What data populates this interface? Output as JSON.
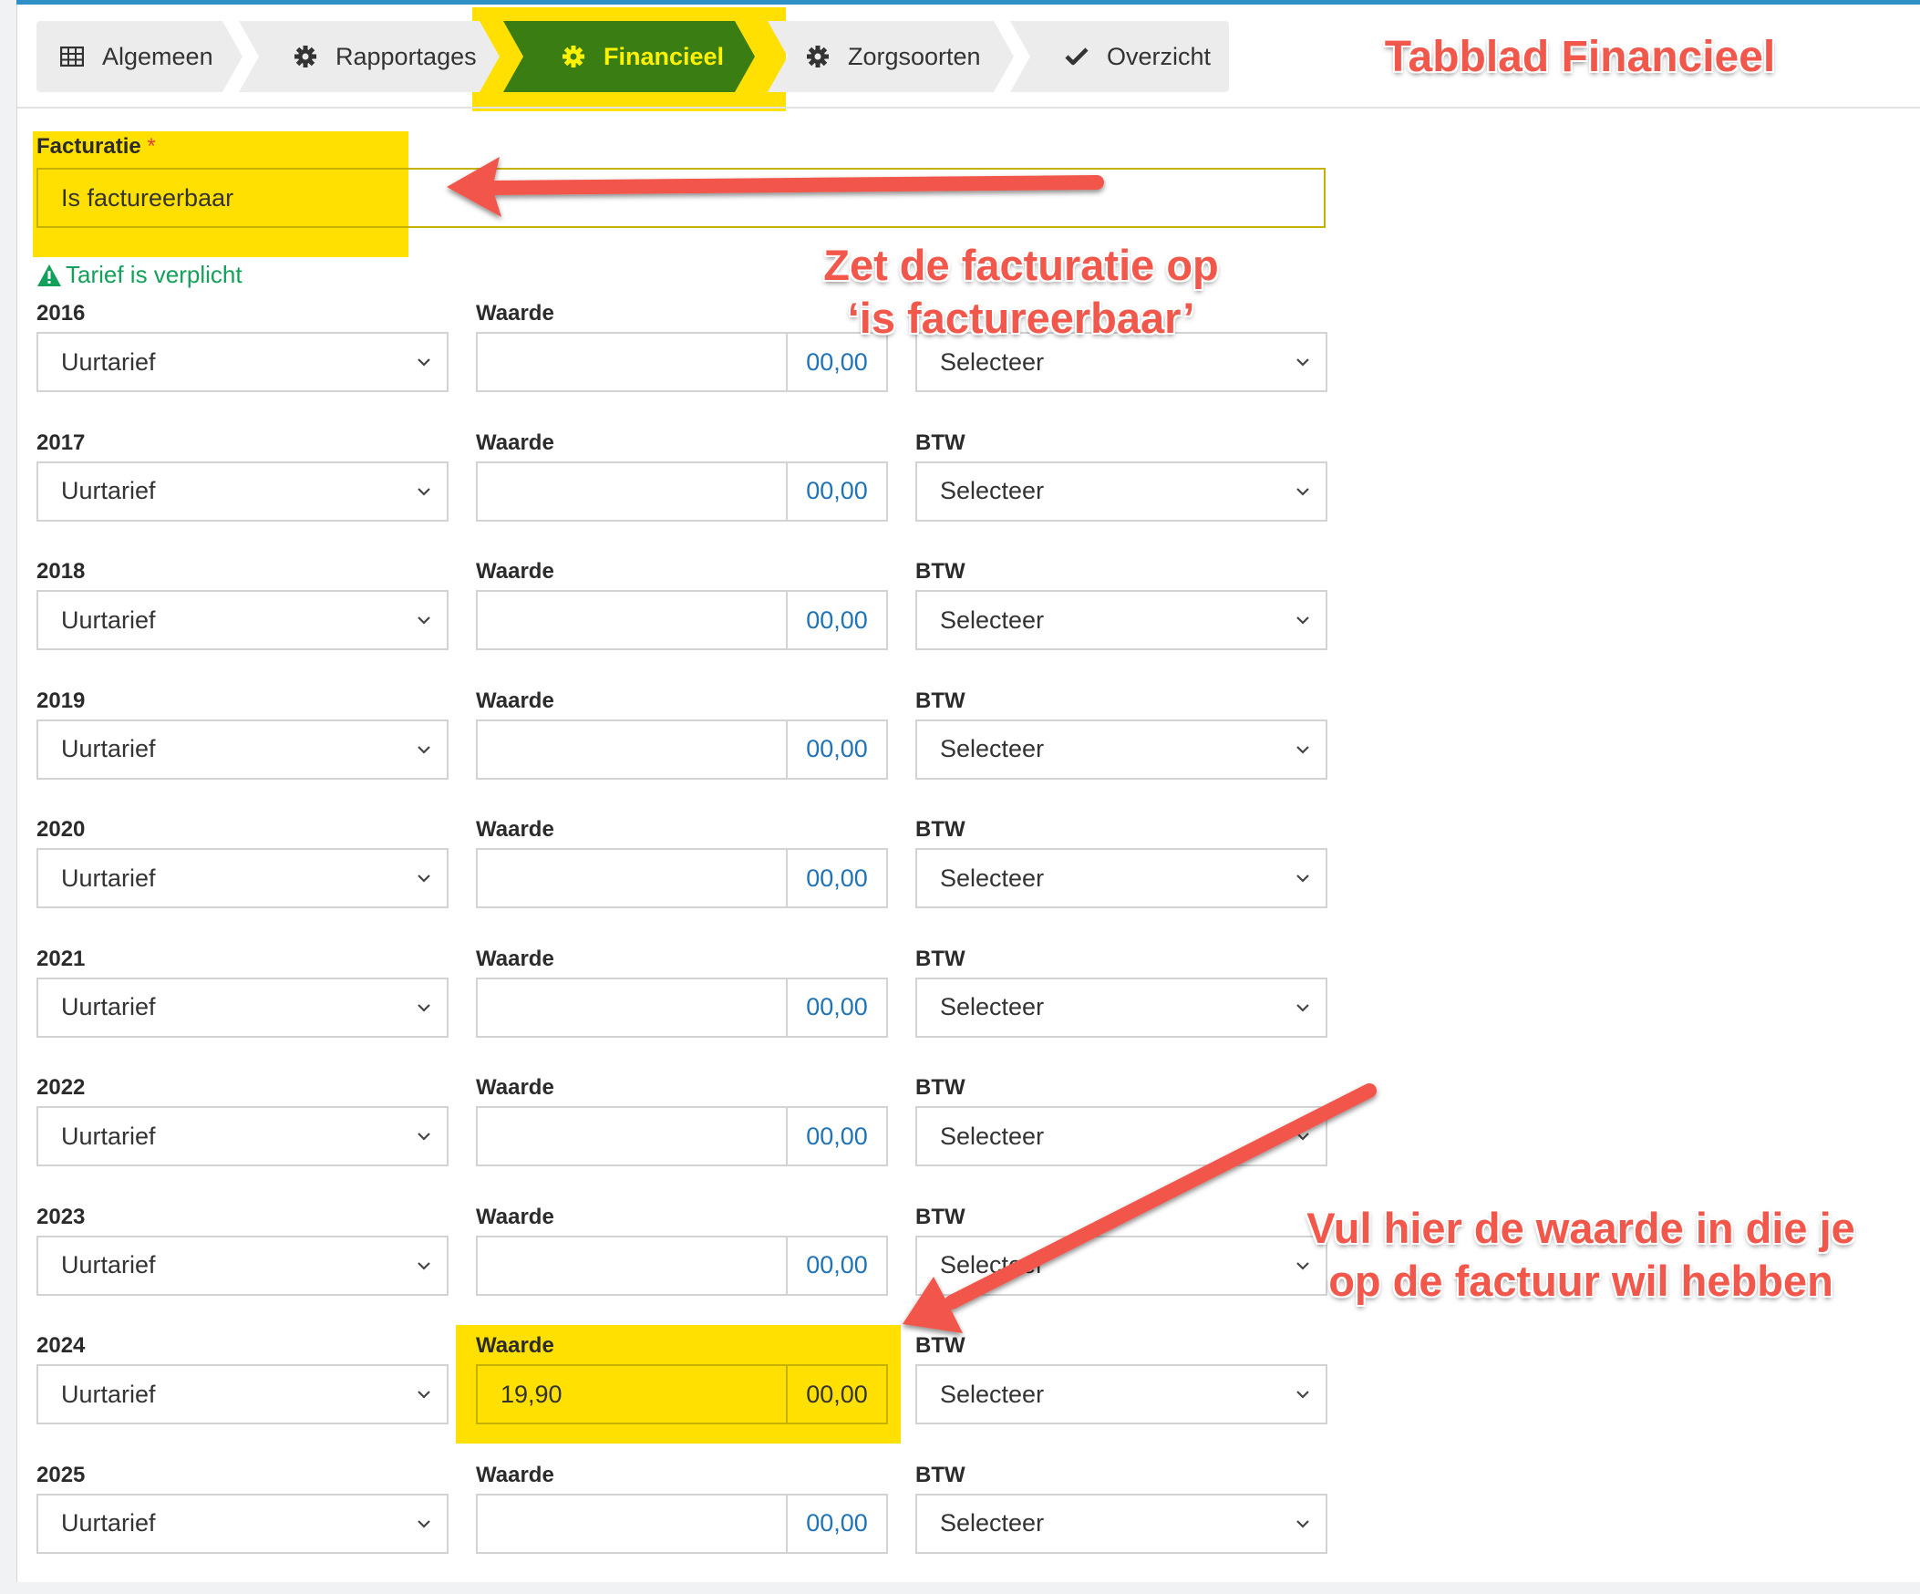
{
  "tabs": [
    {
      "label": "Algemeen",
      "icon": "table-icon"
    },
    {
      "label": "Rapportages",
      "icon": "gear-icon"
    },
    {
      "label": "Financieel",
      "icon": "gear-icon",
      "active": true
    },
    {
      "label": "Zorgsoorten",
      "icon": "gear-icon"
    },
    {
      "label": "Overzicht",
      "icon": "check-icon"
    }
  ],
  "billing": {
    "label": "Facturatie",
    "required_marker": "*",
    "value": "Is factureerbaar"
  },
  "warning": "Tarief is verplicht",
  "column_labels": {
    "value": "Waarde",
    "vat": "BTW"
  },
  "years": [
    {
      "year": "2016",
      "rate_type": "Uurtarief",
      "value": "",
      "suffix": "00,00",
      "vat": "Selecteer"
    },
    {
      "year": "2017",
      "rate_type": "Uurtarief",
      "value": "",
      "suffix": "00,00",
      "vat": "Selecteer"
    },
    {
      "year": "2018",
      "rate_type": "Uurtarief",
      "value": "",
      "suffix": "00,00",
      "vat": "Selecteer"
    },
    {
      "year": "2019",
      "rate_type": "Uurtarief",
      "value": "",
      "suffix": "00,00",
      "vat": "Selecteer"
    },
    {
      "year": "2020",
      "rate_type": "Uurtarief",
      "value": "",
      "suffix": "00,00",
      "vat": "Selecteer"
    },
    {
      "year": "2021",
      "rate_type": "Uurtarief",
      "value": "",
      "suffix": "00,00",
      "vat": "Selecteer"
    },
    {
      "year": "2022",
      "rate_type": "Uurtarief",
      "value": "",
      "suffix": "00,00",
      "vat": "Selecteer"
    },
    {
      "year": "2023",
      "rate_type": "Uurtarief",
      "value": "",
      "suffix": "00,00",
      "vat": "Selecteer"
    },
    {
      "year": "2024",
      "rate_type": "Uurtarief",
      "value": "19,90",
      "suffix": "00,00",
      "vat": "Selecteer"
    },
    {
      "year": "2025",
      "rate_type": "Uurtarief",
      "value": "",
      "suffix": "00,00",
      "vat": "Selecteer"
    }
  ],
  "annotations": {
    "title": "Tabblad Financieel",
    "billing_note": [
      "Zet de facturatie op",
      "‘is factureerbaar’"
    ],
    "value_note": [
      "Vul hier de waarde in die je",
      "op de factuur wil hebben"
    ]
  },
  "colors": {
    "accent": "#2f8fc7",
    "active_tab": "#3a7d12",
    "highlight": "#ffe000",
    "annotation": "#f2574b",
    "warning": "#13a05a"
  }
}
